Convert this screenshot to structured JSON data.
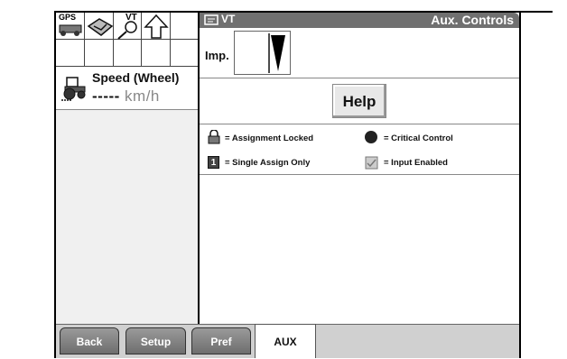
{
  "header": {
    "badge": "VT",
    "title": "Aux. Controls"
  },
  "toolbar_icons": {
    "gps_label": "GPS",
    "vt_label": "VT"
  },
  "speed": {
    "title": "Speed (Wheel)",
    "value": "-----",
    "unit": "km/h"
  },
  "implement": {
    "label": "Imp."
  },
  "help": {
    "label": "Help"
  },
  "legend": {
    "assignment_locked": "= Assignment Locked",
    "critical_control": "= Critical Control",
    "single_assign": "= Single Assign Only",
    "input_enabled": "= Input Enabled",
    "single_assign_badge": "1"
  },
  "tabs": [
    {
      "label": "Back"
    },
    {
      "label": "Setup"
    },
    {
      "label": "Pref"
    },
    {
      "label": "AUX"
    }
  ]
}
